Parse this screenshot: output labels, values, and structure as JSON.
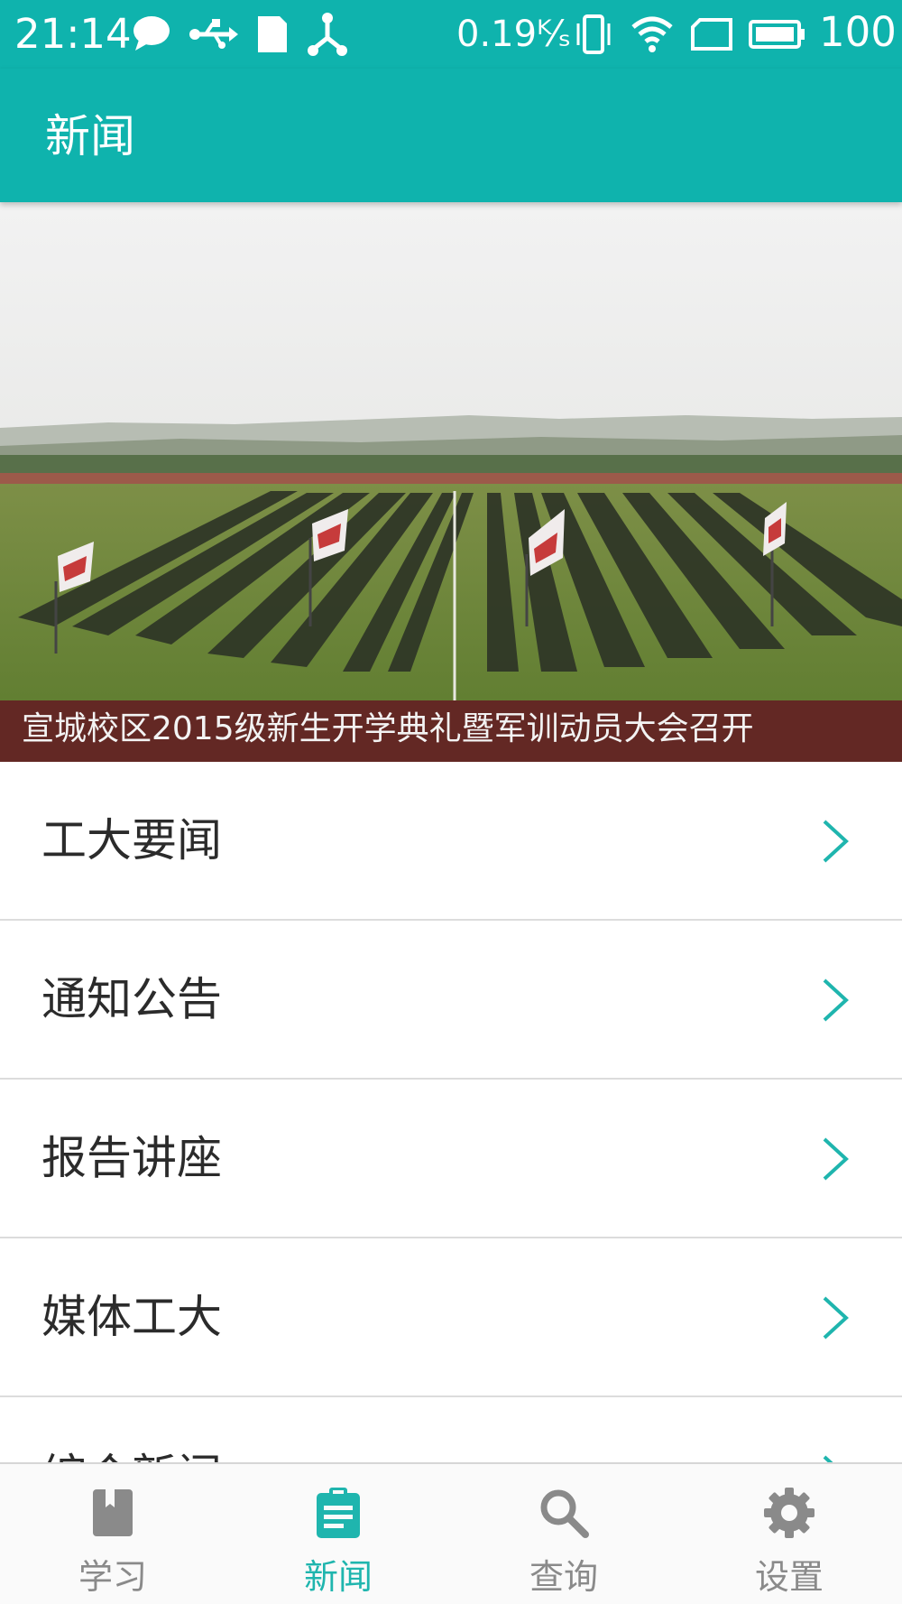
{
  "status_bar": {
    "time": "21:14",
    "network_speed": "0.19ᴷ⁄ₛ",
    "battery": "100",
    "icons": [
      "chat-bubble-icon",
      "usb-icon",
      "sd-card-icon",
      "share-icon",
      "vibrate-icon",
      "wifi-icon",
      "sim-icon",
      "battery-icon"
    ]
  },
  "app_bar": {
    "title": "新闻"
  },
  "banner": {
    "caption": "宣城校区2015级新生开学典礼暨军训动员大会召开"
  },
  "news_list": {
    "items": [
      {
        "label": "工大要闻"
      },
      {
        "label": "通知公告"
      },
      {
        "label": "报告讲座"
      },
      {
        "label": "媒体工大"
      },
      {
        "label": "综合新闻"
      }
    ]
  },
  "bottom_nav": {
    "items": [
      {
        "label": "学习",
        "icon": "book-icon"
      },
      {
        "label": "新闻",
        "icon": "clipboard-icon"
      },
      {
        "label": "查询",
        "icon": "search-icon"
      },
      {
        "label": "设置",
        "icon": "gear-icon"
      }
    ],
    "active_index": 1,
    "active_color": "#1fb5ae",
    "inactive_color": "#8a8a8a"
  },
  "colors": {
    "primary": "#0fb3ad",
    "chevron": "#1fb5ae"
  }
}
